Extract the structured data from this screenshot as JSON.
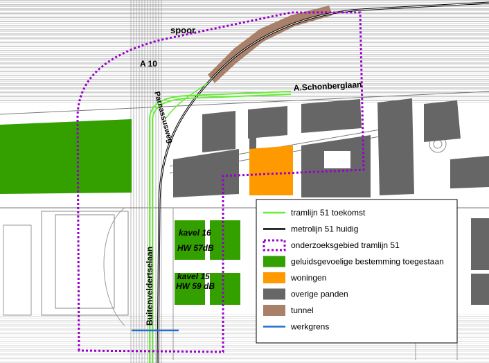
{
  "map": {
    "labels": {
      "spoor": "spoor",
      "a10": "A 10",
      "schonberglaan": "A.Schonberglaan",
      "parnassusweg": "Parnassusweg",
      "buitenveldertselaan": "Buitenveldertselaan",
      "kavel16": "kavel 16",
      "hw16": "HW 57dB",
      "kavel15": "kavel 15",
      "hw15": "HW 59 dB"
    }
  },
  "legend": {
    "items": [
      {
        "label": "tramlijn 51 toekomst",
        "symbol": "line",
        "color": "#66ee33"
      },
      {
        "label": "metrolijn 51 huidig",
        "symbol": "line",
        "color": "#000000"
      },
      {
        "label": "onderzoeksgebied tramlijn 51",
        "symbol": "dotted-box",
        "color": "#9900cc"
      },
      {
        "label": "geluidsgevoelige bestemming toegestaan",
        "symbol": "fill",
        "color": "#33a000"
      },
      {
        "label": "woningen",
        "symbol": "fill",
        "color": "#ff9900"
      },
      {
        "label": "overige panden",
        "symbol": "fill",
        "color": "#666666"
      },
      {
        "label": "tunnel",
        "symbol": "fill",
        "color": "#a9806a"
      },
      {
        "label": "werkgrens",
        "symbol": "line",
        "color": "#1e6fd0"
      }
    ]
  }
}
